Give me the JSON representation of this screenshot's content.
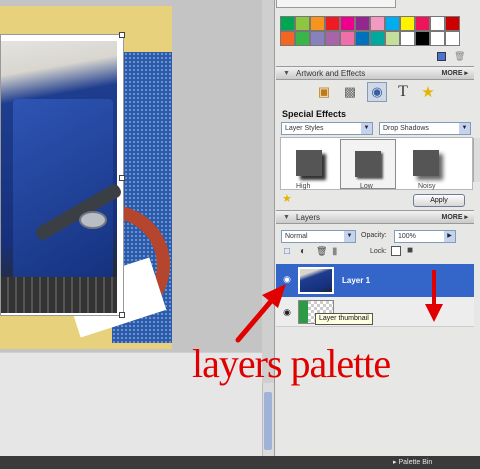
{
  "swatches": [
    "#00a651",
    "#8dc63f",
    "#f7941d",
    "#ed1c24",
    "#ec008c",
    "#92278f",
    "#f49ac1",
    "#00aeef",
    "#fff200",
    "#ed145b",
    "#ffffff",
    "#cc0000",
    "#f26522",
    "#39b54a",
    "#8781bd",
    "#a864a8",
    "#f06eaa",
    "#0072bc",
    "#00a99d",
    "#c4df9b",
    "#ffffff",
    "#000000",
    "#ffffff",
    "#ffffff"
  ],
  "artwork": {
    "title": "Artwork and Effects",
    "more": "MORE ▸",
    "tabs": [
      "artwork-icon",
      "background-icon",
      "effects-icon",
      "text-icon",
      "favorites-icon"
    ],
    "section_title": "Special Effects",
    "category": "Layer Styles",
    "subcategory": "Drop Shadows",
    "effects": [
      "High",
      "Low",
      "Noisy"
    ],
    "apply": "Apply"
  },
  "layers": {
    "title": "Layers",
    "more": "MORE ▸",
    "blend_mode": "Normal",
    "opacity_label": "Opacity:",
    "opacity_value": "100%",
    "lock_label": "Lock:",
    "items": [
      {
        "name": "Layer 1",
        "selected": true
      },
      {
        "name": "",
        "selected": false
      }
    ],
    "tooltip": "Layer thumbnail"
  },
  "status": {
    "palette_bin": "▸ Palette Bin"
  },
  "annotation": {
    "text": "layers palette",
    "color": "#e10000"
  }
}
